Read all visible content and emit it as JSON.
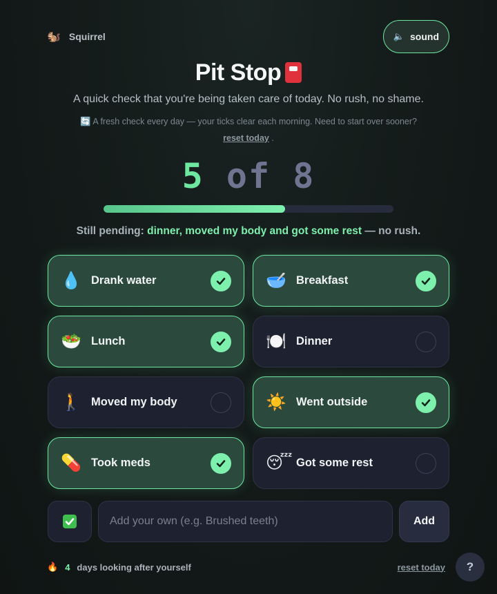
{
  "brand": {
    "emoji": "🐿️",
    "name": "Squirrel"
  },
  "sound": {
    "icon": "speaker-muted-icon",
    "icon_glyph": "🔈",
    "label": "sound"
  },
  "header": {
    "title": "Pit Stop",
    "title_icon": "fuel-pump-icon",
    "subtitle": "A quick check that you're being taken care of today. No rush, no shame.",
    "note_icon": "🔄",
    "note_text": "A fresh check every day — your ticks clear each morning. Need to start over sooner?",
    "note_link": "reset today",
    "note_tail": "."
  },
  "counter": {
    "done": "5",
    "of": "of",
    "total": "8",
    "progress_fraction": 0.625
  },
  "pending": {
    "prefix": "Still pending:",
    "items": "dinner, moved my body and got some rest",
    "suffix": "— no rush."
  },
  "items": [
    {
      "emoji": "💧",
      "label": "Drank water",
      "checked": true
    },
    {
      "emoji": "🥣",
      "label": "Breakfast",
      "checked": true
    },
    {
      "emoji": "🥗",
      "label": "Lunch",
      "checked": true
    },
    {
      "emoji": "🍽️",
      "label": "Dinner",
      "checked": false
    },
    {
      "emoji": "🚶",
      "label": "Moved my body",
      "checked": false
    },
    {
      "emoji": "☀️",
      "label": "Went outside",
      "checked": true
    },
    {
      "emoji": "💊",
      "label": "Took meds",
      "checked": true
    },
    {
      "emoji": "😴",
      "label": "Got some rest",
      "checked": false
    }
  ],
  "add": {
    "emoji_icon": "check-box-icon",
    "placeholder": "Add your own (e.g. Brushed teeth)",
    "button_label": "Add"
  },
  "footer": {
    "fire": "🔥",
    "streak_count": "4",
    "streak_text": "days looking after yourself",
    "reset_link": "reset today",
    "help_label": "?"
  },
  "colors": {
    "accent": "#7ef0ae",
    "card_checked_bg": "#2b4a3d",
    "card_bg": "#1d2130",
    "background": "#131a19"
  }
}
